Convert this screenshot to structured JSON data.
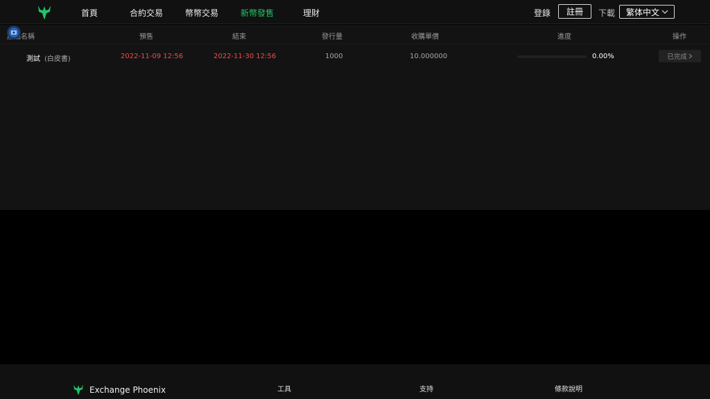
{
  "header": {
    "nav": [
      "首頁",
      "合約交易",
      "幣幣交易",
      "新幣發售",
      "理財"
    ],
    "active_index": 3,
    "login": "登錄",
    "register": "註冊",
    "download": "下載",
    "language": "繁体中文"
  },
  "table": {
    "columns": [
      "產品名稱",
      "預售",
      "結束",
      "發行量",
      "收購單價",
      "進度",
      "操作"
    ],
    "rows": [
      {
        "icon": "coin-icon",
        "name": "測試",
        "whitepaper": "(白皮書)",
        "presale": "2022-11-09 12:56",
        "end": "2022-11-30 12:56",
        "supply": "1000",
        "price": "10.000000",
        "progress_percent": 0,
        "progress_label": "0.00%",
        "action": "已完成"
      }
    ]
  },
  "footer": {
    "brand": "Exchange Phoenix",
    "columns": [
      "工具",
      "支持",
      "條款說明"
    ]
  },
  "colors": {
    "accent": "#22c36a",
    "date_red": "#f24b4b",
    "panel": "#131313",
    "header": "#111111"
  }
}
